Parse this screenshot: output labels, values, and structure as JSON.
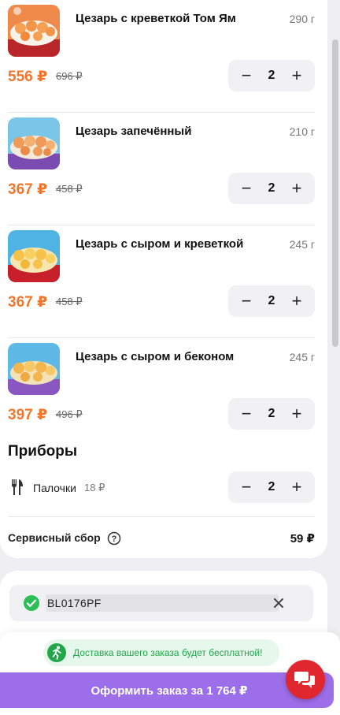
{
  "cart": {
    "items": [
      {
        "name": "Цезарь с креветкой Том Ям",
        "weight": "290 г",
        "price": "556 ₽",
        "old_price": "696 ₽",
        "quantity": "2",
        "image": "sushi-rolls-image"
      },
      {
        "name": "Цезарь запечённый",
        "weight": "210 г",
        "price": "367 ₽",
        "old_price": "458 ₽",
        "quantity": "2",
        "image": "sushi-rolls-image"
      },
      {
        "name": "Цезарь с сыром и креветкой",
        "weight": "245 г",
        "price": "367 ₽",
        "old_price": "458 ₽",
        "quantity": "2",
        "image": "sushi-rolls-image"
      },
      {
        "name": "Цезарь с сыром и беконом",
        "weight": "245 г",
        "price": "397 ₽",
        "old_price": "496 ₽",
        "quantity": "2",
        "image": "sushi-rolls-image"
      }
    ],
    "stepper": {
      "minus": "−",
      "plus": "+"
    }
  },
  "utensils": {
    "title": "Приборы",
    "icon": "fork-knife-icon",
    "name": "Палочки",
    "price": "18 ₽",
    "quantity": "2"
  },
  "service_fee": {
    "label": "Сервисный сбор",
    "value": "59 ₽",
    "icon": "help-icon"
  },
  "promo": {
    "code": "BL0176PF",
    "status_icon": "check-circle-icon",
    "remove_icon": "close-icon"
  },
  "footer": {
    "free_delivery_text": "Доставка вашего заказа будет бесплатной!",
    "checkout_label": "Оформить заказ за 1 764 ₽",
    "chat_icon": "chat-icon"
  },
  "colors": {
    "price": "#f2772c",
    "checkout": "#9d6ee9",
    "success": "#21a74a",
    "chat": "#e0262f"
  }
}
